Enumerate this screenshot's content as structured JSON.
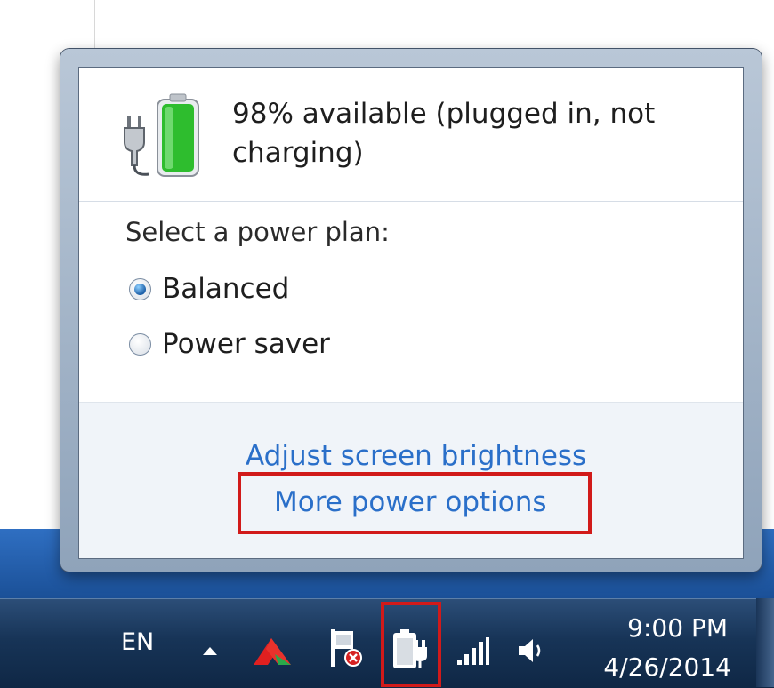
{
  "flyout": {
    "status_text": "98% available (plugged in, not charging)",
    "battery_percent": 98,
    "plan_heading": "Select a power plan:",
    "plans": [
      {
        "label": "Balanced",
        "selected": true
      },
      {
        "label": "Power saver",
        "selected": false
      }
    ],
    "links": {
      "brightness": "Adjust screen brightness",
      "more_options": "More power options"
    }
  },
  "taskbar": {
    "language": "EN",
    "clock": {
      "time": "9:00 PM",
      "date": "4/26/2014"
    },
    "icons": [
      "show-hidden-icons-arrow",
      "app-tray-icon",
      "action-center-flag-icon",
      "power-plug-icon",
      "network-signal-icon",
      "volume-icon"
    ]
  },
  "colors": {
    "link": "#2a6fc9",
    "highlight": "#d11a1a",
    "radio_selected": "#1c5fa8",
    "battery_fill": "#2ebd2e"
  }
}
